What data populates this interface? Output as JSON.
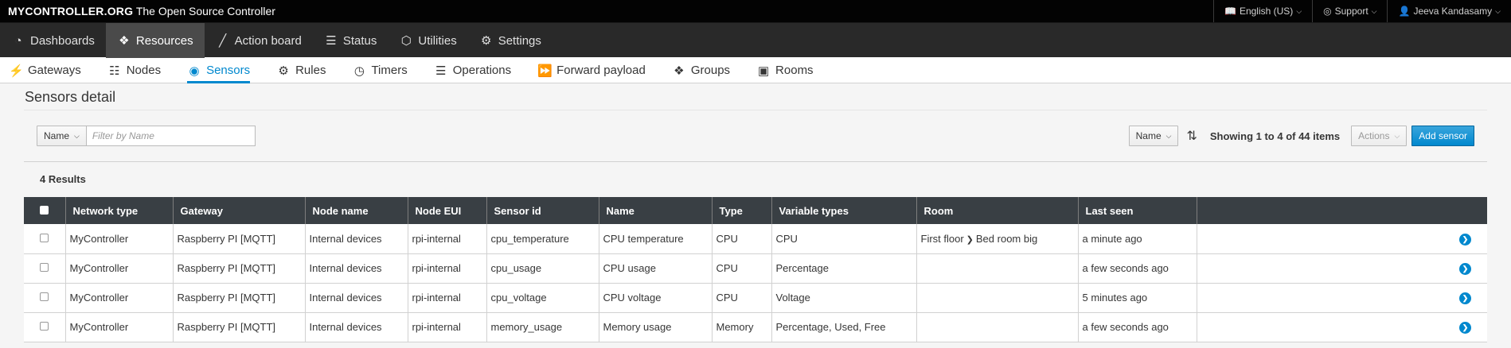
{
  "topbar": {
    "brand_bold": "MYCONTROLLER.ORG",
    "brand_tagline": "The Open Source Controller",
    "language": "English (US)",
    "support": "Support",
    "user": "Jeeva Kandasamy"
  },
  "mainnav": [
    {
      "label": "Dashboards",
      "icon": "tachometer-icon"
    },
    {
      "label": "Resources",
      "icon": "cubes-icon"
    },
    {
      "label": "Action board",
      "icon": "magic-wand-icon"
    },
    {
      "label": "Status",
      "icon": "file-icon"
    },
    {
      "label": "Utilities",
      "icon": "cube-icon"
    },
    {
      "label": "Settings",
      "icon": "gear-icon"
    }
  ],
  "subnav": [
    {
      "label": "Gateways",
      "icon": "plug-icon"
    },
    {
      "label": "Nodes",
      "icon": "sitemap-icon"
    },
    {
      "label": "Sensors",
      "icon": "eye-icon"
    },
    {
      "label": "Rules",
      "icon": "gears-icon"
    },
    {
      "label": "Timers",
      "icon": "clock-icon"
    },
    {
      "label": "Operations",
      "icon": "list-icon"
    },
    {
      "label": "Forward payload",
      "icon": "forward-icon"
    },
    {
      "label": "Groups",
      "icon": "cubes-icon"
    },
    {
      "label": "Rooms",
      "icon": "object-group-icon"
    }
  ],
  "page": {
    "title": "Sensors detail",
    "filter_field": "Name",
    "filter_placeholder": "Filter by Name",
    "sort_field": "Name",
    "showing": "Showing 1 to 4 of 44 items",
    "actions_label": "Actions",
    "add_label": "Add sensor",
    "results": "4 Results"
  },
  "table": {
    "headers": [
      "Network type",
      "Gateway",
      "Node name",
      "Node EUI",
      "Sensor id",
      "Name",
      "Type",
      "Variable types",
      "Room",
      "Last seen"
    ],
    "rows": [
      {
        "network": "MyController",
        "gateway": "Raspberry PI [MQTT]",
        "node_name": "Internal devices",
        "node_eui": "rpi-internal",
        "sensor_id": "cpu_temperature",
        "name": "CPU temperature",
        "type": "CPU",
        "variable_types": "CPU",
        "room_parent": "First floor",
        "room_child": "Bed room big",
        "last_seen": "a minute ago"
      },
      {
        "network": "MyController",
        "gateway": "Raspberry PI [MQTT]",
        "node_name": "Internal devices",
        "node_eui": "rpi-internal",
        "sensor_id": "cpu_usage",
        "name": "CPU usage",
        "type": "CPU",
        "variable_types": "Percentage",
        "room_parent": "",
        "room_child": "",
        "last_seen": "a few seconds ago"
      },
      {
        "network": "MyController",
        "gateway": "Raspberry PI [MQTT]",
        "node_name": "Internal devices",
        "node_eui": "rpi-internal",
        "sensor_id": "cpu_voltage",
        "name": "CPU voltage",
        "type": "CPU",
        "variable_types": "Voltage",
        "room_parent": "",
        "room_child": "",
        "last_seen": "5 minutes ago"
      },
      {
        "network": "MyController",
        "gateway": "Raspberry PI [MQTT]",
        "node_name": "Internal devices",
        "node_eui": "rpi-internal",
        "sensor_id": "memory_usage",
        "name": "Memory usage",
        "type": "Memory",
        "variable_types": "Percentage, Used, Free",
        "room_parent": "",
        "room_child": "",
        "last_seen": "a few seconds ago"
      }
    ]
  },
  "colors": {
    "accent": "#0088ce",
    "topbar": "#030303",
    "nav": "#292929",
    "table_header": "#393f44"
  }
}
